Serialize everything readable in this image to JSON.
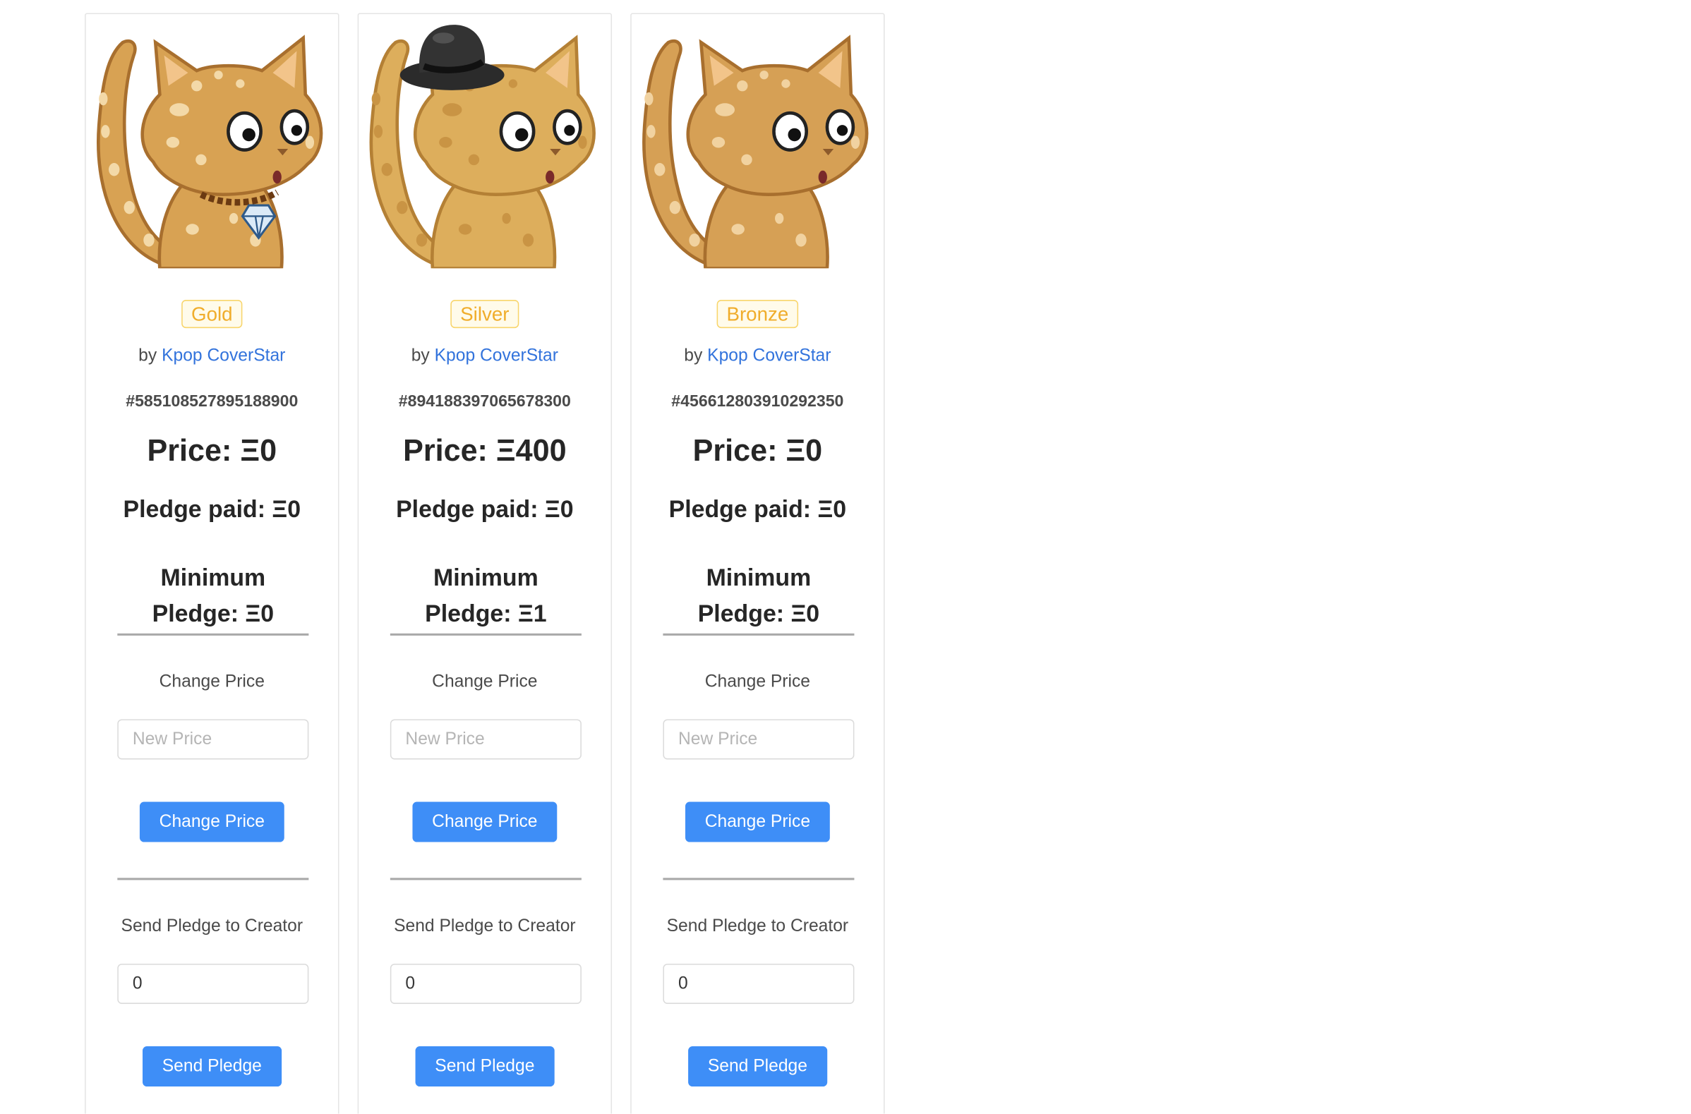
{
  "cards": [
    {
      "tier": "Gold",
      "by_prefix": "by",
      "creator": "Kpop CoverStar",
      "token_id": "#585108527895188900",
      "price": "Price: Ξ0",
      "pledge_paid": "Pledge paid: Ξ0",
      "minimum_pledge": "Minimum Pledge: Ξ0",
      "change_price_label": "Change Price",
      "new_price_placeholder": "New Price",
      "new_price_value": "",
      "change_price_button": "Change Price",
      "send_pledge_label": "Send Pledge to Creator",
      "pledge_amount_value": "0",
      "send_pledge_button": "Send Pledge",
      "cat": {
        "fur": "#d8a253",
        "spots": "#f3d9a8",
        "outline": "#a86f2e",
        "accessory": "diamond-collar"
      }
    },
    {
      "tier": "Silver",
      "by_prefix": "by",
      "creator": "Kpop CoverStar",
      "token_id": "#894188397065678300",
      "price": "Price: Ξ400",
      "pledge_paid": "Pledge paid: Ξ0",
      "minimum_pledge": "Minimum Pledge: Ξ1",
      "change_price_label": "Change Price",
      "new_price_placeholder": "New Price",
      "new_price_value": "",
      "change_price_button": "Change Price",
      "send_pledge_label": "Send Pledge to Creator",
      "pledge_amount_value": "0",
      "send_pledge_button": "Send Pledge",
      "cat": {
        "fur": "#ddae5c",
        "spots": "#c99444",
        "outline": "#b48035",
        "accessory": "top-hat"
      }
    },
    {
      "tier": "Bronze",
      "by_prefix": "by",
      "creator": "Kpop CoverStar",
      "token_id": "#456612803910292350",
      "price": "Price: Ξ0",
      "pledge_paid": "Pledge paid: Ξ0",
      "minimum_pledge": "Minimum Pledge: Ξ0",
      "change_price_label": "Change Price",
      "new_price_placeholder": "New Price",
      "new_price_value": "",
      "change_price_button": "Change Price",
      "send_pledge_label": "Send Pledge to Creator",
      "pledge_amount_value": "0",
      "send_pledge_button": "Send Pledge",
      "cat": {
        "fur": "#d6a055",
        "spots": "#f1d2a0",
        "outline": "#a86f2e",
        "accessory": "none"
      }
    }
  ],
  "colors": {
    "link": "#3273dc",
    "button": "#3e8ef7",
    "badge_text": "#f0ad2b",
    "badge_border": "#f8d56b"
  }
}
